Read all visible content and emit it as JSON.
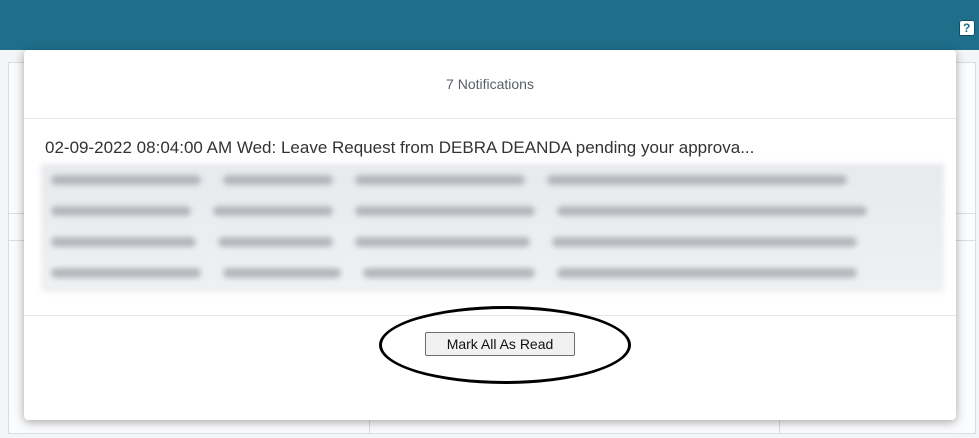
{
  "header": {
    "help_icon_label": "?"
  },
  "modal": {
    "title": "7 Notifications",
    "first_notification": "02-09-2022 08:04:00 AM Wed: Leave Request from DEBRA DEANDA pending your approva...",
    "mark_all_read_label": "Mark All As Read"
  },
  "colors": {
    "topbar": "#1f6f8b",
    "highlight": "#000000"
  }
}
